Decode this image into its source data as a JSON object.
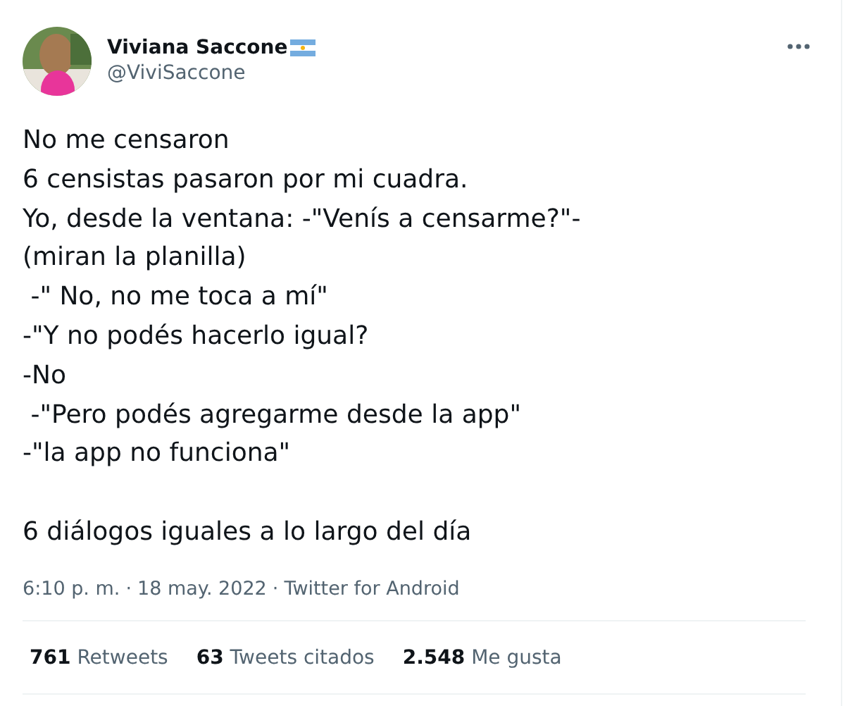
{
  "author": {
    "name": "Viviana Saccone",
    "handle": "@ViviSaccone"
  },
  "tweet": {
    "paragraphs": [
      [
        "No me censaron",
        "6 censistas pasaron por mi cuadra.",
        "Yo, desde la ventana: -\"Venís a censarme?\"-",
        "(miran la planilla)",
        " -\" No, no me toca a mí\"",
        "-\"Y no podés hacerlo igual?",
        "-No",
        " -\"Pero podés agregarme desde la app\"",
        "-\"la app no funciona\""
      ],
      [
        "6 diálogos iguales a lo largo del día"
      ]
    ]
  },
  "meta": {
    "time": "6:10 p. m.",
    "separator_1": "·",
    "date": "18 may. 2022",
    "separator_2": "·",
    "source": "Twitter for Android"
  },
  "stats": [
    {
      "count": "761",
      "label": "Retweets"
    },
    {
      "count": "63",
      "label": "Tweets citados"
    },
    {
      "count": "2.548",
      "label": "Me gusta"
    }
  ]
}
